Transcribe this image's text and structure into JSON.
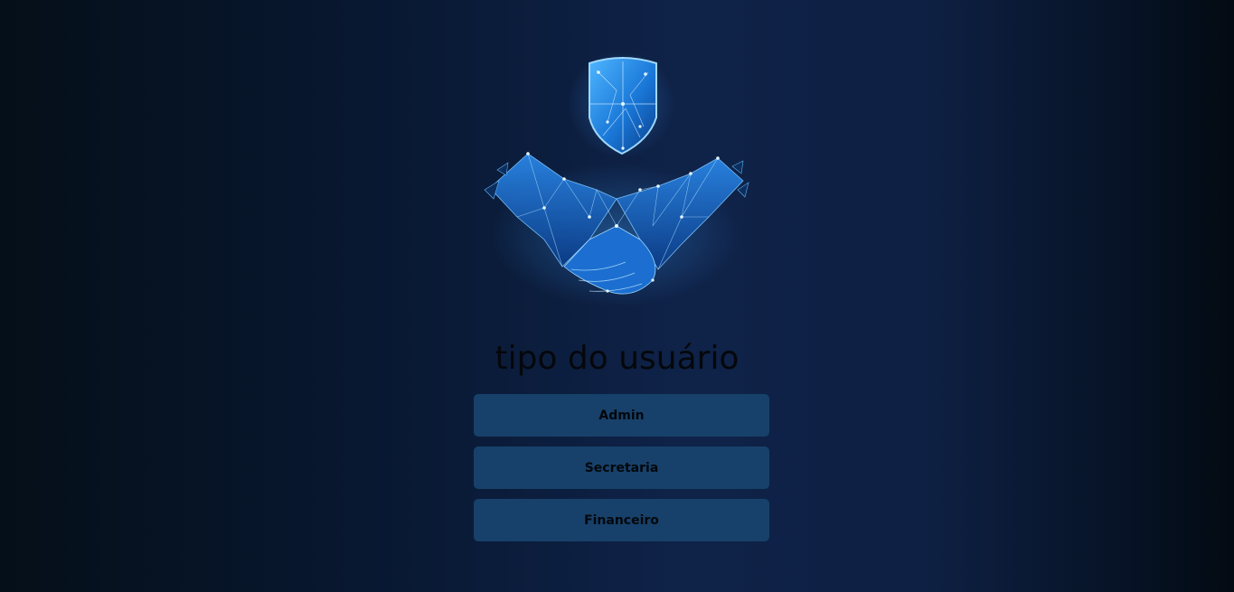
{
  "hero": {
    "shield_icon": "shield-icon",
    "handshake_icon": "handshake-icon",
    "accent_color": "#1e7fe0"
  },
  "page": {
    "title": "tipo do usuário"
  },
  "options": [
    {
      "label": "Admin"
    },
    {
      "label": "Secretaria"
    },
    {
      "label": "Financeiro"
    }
  ],
  "colors": {
    "button_bg": "#17416a",
    "background": "#0f2248"
  }
}
